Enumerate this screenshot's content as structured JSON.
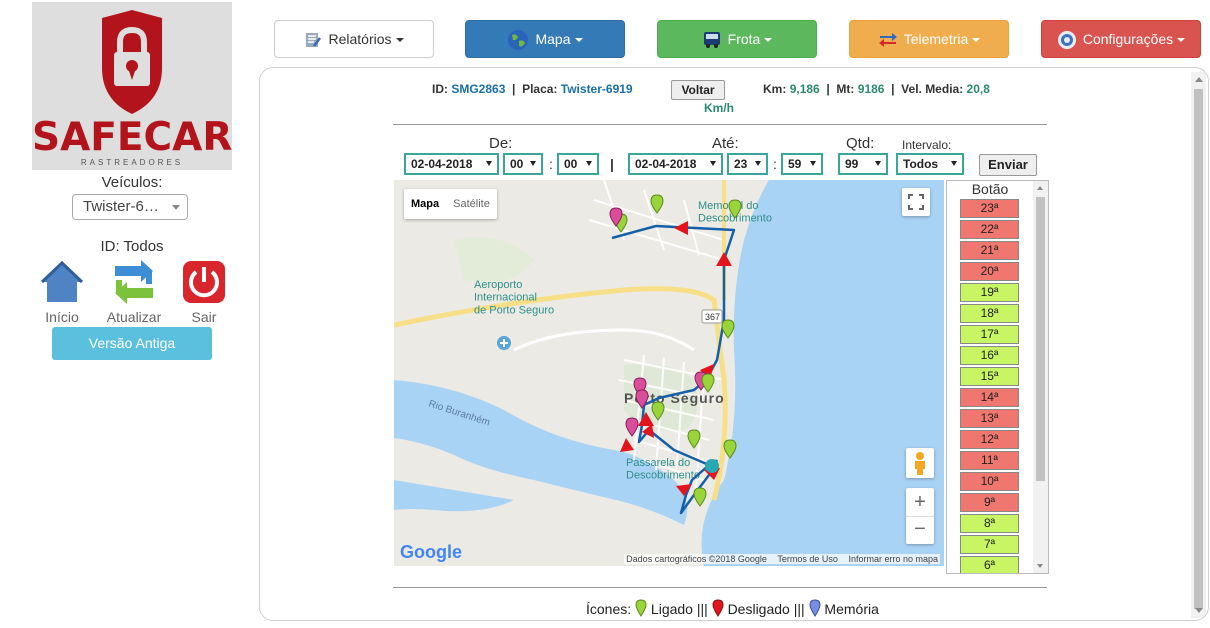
{
  "sidebar": {
    "logo_text": "SAFECAR",
    "logo_sub": "RASTREADORES",
    "veiculos_label": "Veículos:",
    "veiculo_selected": "Twister-6…",
    "id_label": "ID: Todos",
    "buttons": [
      {
        "label": "Início",
        "icon": "home-icon"
      },
      {
        "label": "Atualizar",
        "icon": "refresh-icon"
      },
      {
        "label": "Sair",
        "icon": "power-icon"
      }
    ],
    "versao": "Versão Antiga"
  },
  "nav": [
    {
      "label": "Relatórios",
      "icon": "report-icon",
      "bg": "#ffffff",
      "fg": "#333333"
    },
    {
      "label": "Mapa",
      "icon": "globe-icon",
      "bg": "#337ab7",
      "fg": "#ffffff"
    },
    {
      "label": "Frota",
      "icon": "bus-icon",
      "bg": "#5cb85c",
      "fg": "#ffffff"
    },
    {
      "label": "Telemetria",
      "icon": "transfer-icon",
      "bg": "#f0ad4e",
      "fg": "#ffffff"
    },
    {
      "label": "Configurações",
      "icon": "gear-icon",
      "bg": "#d9534f",
      "fg": "#ffffff"
    }
  ],
  "info": {
    "id_label": "ID:",
    "id_value": "SMG2863",
    "placa_label": "Placa:",
    "placa_value": "Twister-6919",
    "voltar": "Voltar",
    "km_label": "Km:",
    "km_value": "9,186",
    "mt_label": "Mt:",
    "mt_value": "9186",
    "vel_label": "Vel. Media:",
    "vel_value": "20,8",
    "vel_unit": "Km/h"
  },
  "filters": {
    "de_label": "De:",
    "ate_label": "Até:",
    "qtd_label": "Qtd:",
    "intervalo_label": "Intervalo:",
    "de_date": "02-04-2018",
    "de_hour": "00",
    "de_min": "00",
    "ate_date": "02-04-2018",
    "ate_hour": "23",
    "ate_min": "59",
    "qtd": "99",
    "intervalo": "Todos",
    "separator": "|",
    "colon": ":",
    "enviar": "Enviar"
  },
  "map": {
    "tab_mapa": "Mapa",
    "tab_satelite": "Satélite",
    "labels": {
      "memorial": "Memorial do Descobrimento",
      "aeroporto": "Aeroporto Internacional de Porto Seguro",
      "porto_seguro": "Porto Seguro",
      "passarela": "Passarela do Descobrimento",
      "rio": "Rio Buranhém",
      "road": "367"
    },
    "attribution": "Dados cartográficos ©2018 Google",
    "terms": "Termos de Uso",
    "report": "Informar erro no mapa",
    "google": "Google",
    "zoom_in": "+",
    "zoom_out": "−"
  },
  "botao": {
    "title": "Botão",
    "items": [
      {
        "label": "23ª",
        "state": "red"
      },
      {
        "label": "22ª",
        "state": "red"
      },
      {
        "label": "21ª",
        "state": "red"
      },
      {
        "label": "20ª",
        "state": "red"
      },
      {
        "label": "19ª",
        "state": "green"
      },
      {
        "label": "18ª",
        "state": "green"
      },
      {
        "label": "17ª",
        "state": "green"
      },
      {
        "label": "16ª",
        "state": "green"
      },
      {
        "label": "15ª",
        "state": "green"
      },
      {
        "label": "14ª",
        "state": "red"
      },
      {
        "label": "13ª",
        "state": "red"
      },
      {
        "label": "12ª",
        "state": "red"
      },
      {
        "label": "11ª",
        "state": "red"
      },
      {
        "label": "10ª",
        "state": "red"
      },
      {
        "label": "9ª",
        "state": "red"
      },
      {
        "label": "8ª",
        "state": "green"
      },
      {
        "label": "7ª",
        "state": "green"
      },
      {
        "label": "6ª",
        "state": "green"
      }
    ],
    "colors": {
      "red": "#f0776f",
      "green": "#c8f564"
    }
  },
  "legend": {
    "prefix": "Ícones:",
    "ligado": "Ligado",
    "desligado": "Desligado",
    "memoria": "Memória",
    "sep": "|||"
  }
}
